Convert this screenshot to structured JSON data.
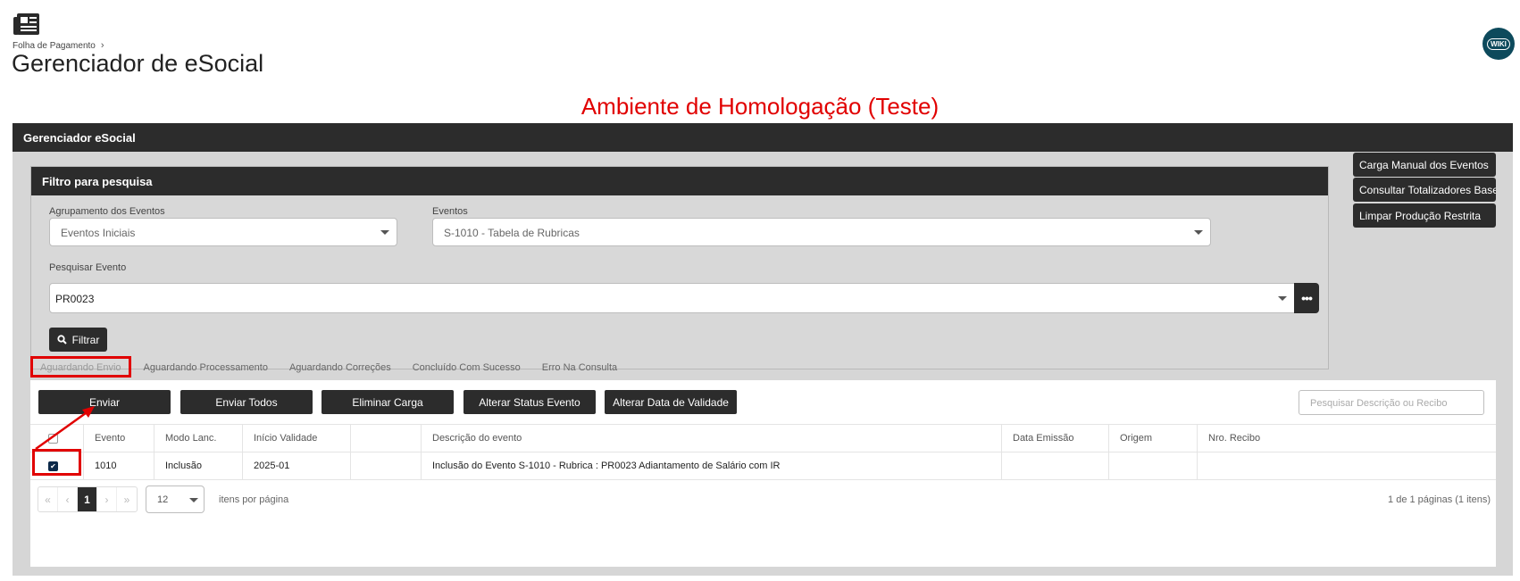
{
  "header": {
    "breadcrumb": "Folha de Pagamento",
    "title": "Gerenciador de eSocial",
    "wiki_label": "WIKI",
    "app_icon": "newspaper-icon"
  },
  "environment_banner": "Ambiente de Homologação (Teste)",
  "panel": {
    "title": "Gerenciador eSocial"
  },
  "filter": {
    "title": "Filtro para pesquisa",
    "group_label": "Agrupamento dos Eventos",
    "group_value": "Eventos Iniciais",
    "events_label": "Eventos",
    "events_value": "S-1010 - Tabela de Rubricas",
    "search_label": "Pesquisar Evento",
    "search_value": "PR0023",
    "more_label": "•••",
    "filter_button": "Filtrar"
  },
  "side_buttons": [
    "Carga Manual dos Eventos",
    "Consultar Totalizadores Base",
    "Limpar Produção Restrita"
  ],
  "tabs": [
    "Aguardando Envio",
    "Aguardando Processamento",
    "Aguardando Correções",
    "Concluído Com Sucesso",
    "Erro Na Consulta"
  ],
  "actions": [
    "Enviar",
    "Enviar Todos",
    "Eliminar Carga",
    "Alterar Status Evento",
    "Alterar Data de Validade"
  ],
  "search_desc_placeholder": "Pesquisar Descrição ou Recibo",
  "table": {
    "columns": [
      "",
      "Evento",
      "Modo Lanc.",
      "Início Validade",
      "",
      "Descrição do evento",
      "Data Emissão",
      "Origem",
      "Nro. Recibo"
    ],
    "rows": [
      {
        "checked": true,
        "evento": "1010",
        "modo": "Inclusão",
        "inicio": "2025-01",
        "extra": "",
        "descricao": "Inclusão do Evento S-1010 - Rubrica : PR0023 Adiantamento de Salário com IR",
        "data_emissao": "",
        "origem": "",
        "recibo": ""
      }
    ]
  },
  "pager": {
    "first": "«",
    "prev": "‹",
    "current": "1",
    "next": "›",
    "last": "»",
    "page_size": "12",
    "per_page_label": "itens por página",
    "info": "1 de 1 páginas (1 itens)"
  },
  "colors": {
    "dark": "#2c2c2c",
    "accent_red": "#e10000",
    "panel_gray": "#d6d6d6",
    "wiki_teal": "#0d4a5c"
  }
}
